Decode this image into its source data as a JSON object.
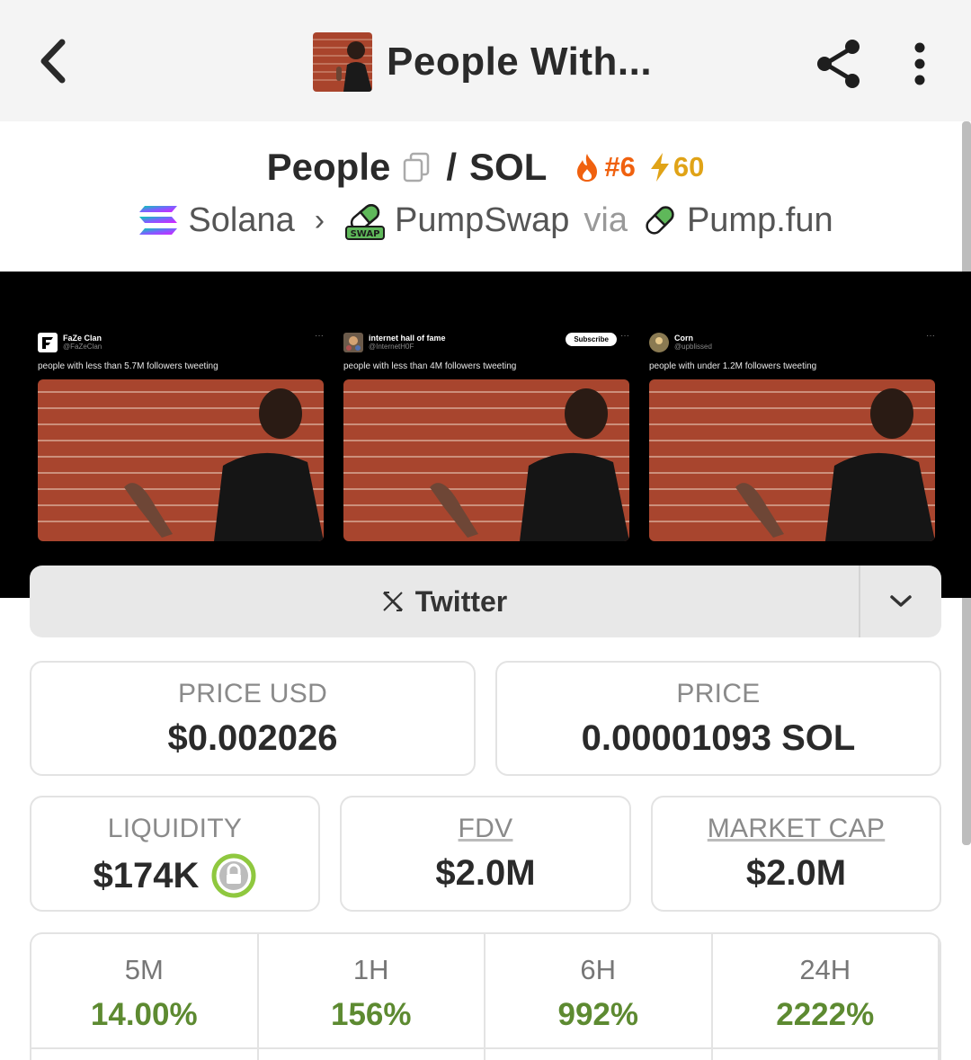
{
  "header": {
    "title": "People With...",
    "back_icon": "chevron-left-icon",
    "share_icon": "share-icon",
    "more_icon": "more-vertical-icon"
  },
  "pair": {
    "base": "People",
    "separator": "/",
    "quote": "SOL",
    "rank": "#6",
    "boosts": "60",
    "rank_color": "#f0610f",
    "boost_color": "#e0a317"
  },
  "chain": {
    "network": "Solana",
    "dex": "PumpSwap",
    "via_label": "via",
    "launchpad": "Pump.fun",
    "swap_badge": "SWAP"
  },
  "banner": {
    "tweets": [
      {
        "name": "FaZe Clan",
        "handle": "@FaZeClan",
        "text": "people with less than 5.7M followers tweeting"
      },
      {
        "name": "internet hall of fame",
        "handle": "@InternetH0F",
        "text": "people with less than 4M followers tweeting",
        "action": "Subscribe"
      },
      {
        "name": "Corn",
        "handle": "@upblissed",
        "text": "people with under 1.2M followers tweeting"
      }
    ]
  },
  "social": {
    "label": "Twitter",
    "icon": "x-logo-icon"
  },
  "stats": {
    "price_usd_label": "PRICE USD",
    "price_usd": "$0.002026",
    "price_label": "PRICE",
    "price": "0.00001093 SOL",
    "liquidity_label": "LIQUIDITY",
    "liquidity": "$174K",
    "fdv_label": "FDV",
    "fdv": "$2.0M",
    "mcap_label": "MARKET CAP",
    "mcap": "$2.0M"
  },
  "timeframes": [
    {
      "label": "5M",
      "value": "14.00%"
    },
    {
      "label": "1H",
      "value": "156%"
    },
    {
      "label": "6H",
      "value": "992%"
    },
    {
      "label": "24H",
      "value": "2222%"
    }
  ],
  "colors": {
    "positive": "#5d8a31",
    "liquidity_lock": "#8fc83f"
  }
}
